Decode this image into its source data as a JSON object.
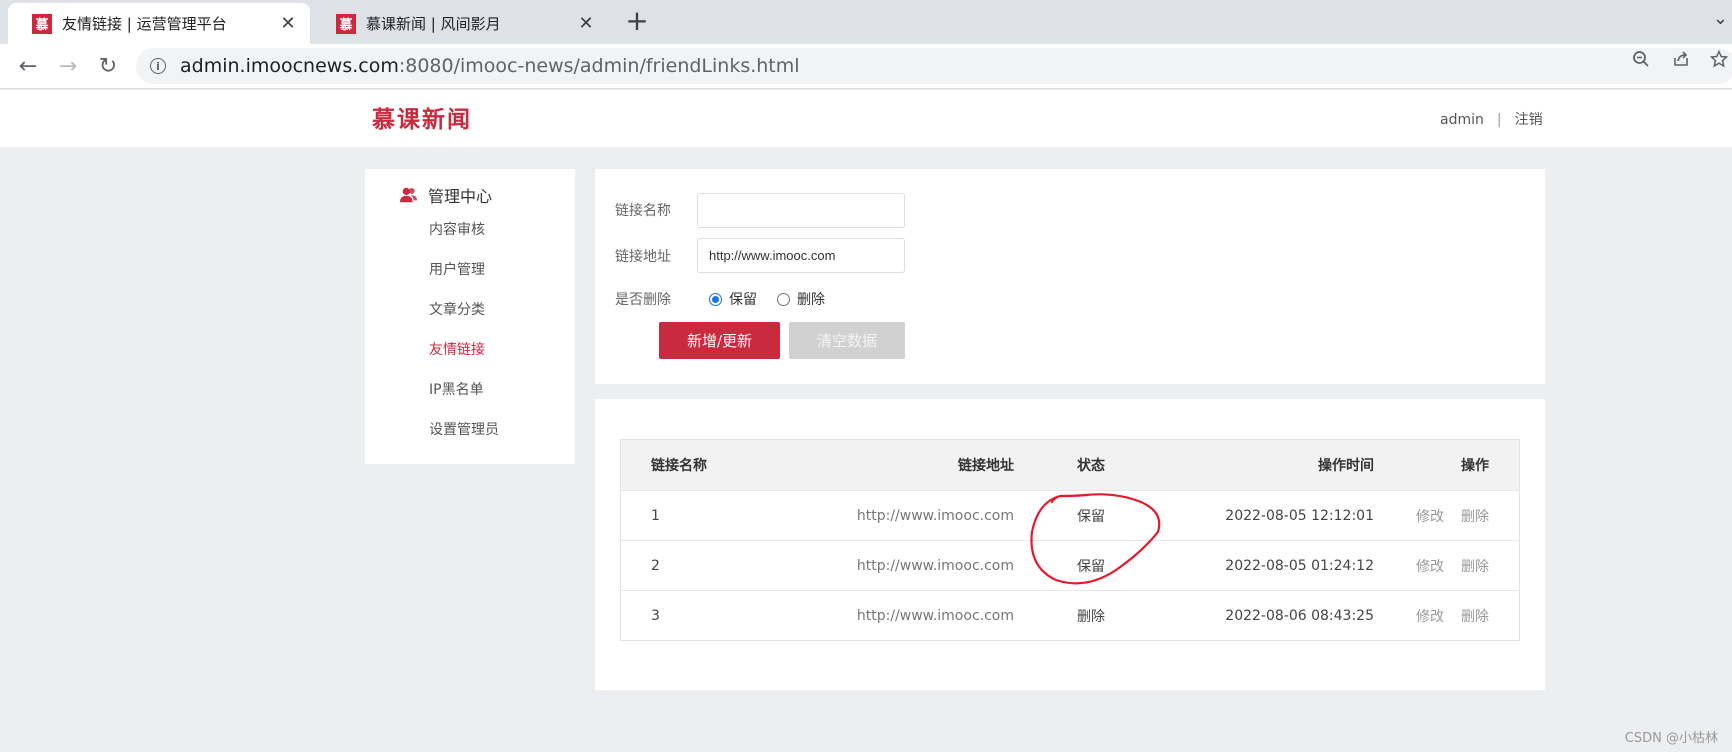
{
  "browser": {
    "tabs": [
      {
        "favicon": "慕",
        "title": "友情链接 | 运营管理平台",
        "active": true
      },
      {
        "favicon": "慕",
        "title": "慕课新闻 | 风间影月",
        "active": false
      }
    ],
    "url_host": "admin.imoocnews.com",
    "url_rest": ":8080/imooc-news/admin/friendLinks.html"
  },
  "header": {
    "logo": "慕课新闻",
    "username": "admin",
    "separator": "|",
    "logout": "注销"
  },
  "sidebar": {
    "title": "管理中心",
    "items": [
      {
        "label": "内容审核",
        "active": false
      },
      {
        "label": "用户管理",
        "active": false
      },
      {
        "label": "文章分类",
        "active": false
      },
      {
        "label": "友情链接",
        "active": true
      },
      {
        "label": "IP黑名单",
        "active": false
      },
      {
        "label": "设置管理员",
        "active": false
      }
    ]
  },
  "form": {
    "name_label": "链接名称",
    "name_value": "",
    "url_label": "链接地址",
    "url_value": "http://www.imooc.com",
    "delete_label": "是否删除",
    "option_keep": "保留",
    "option_delete": "删除",
    "selected": "保留",
    "submit_label": "新增/更新",
    "clear_label": "清空数据"
  },
  "table": {
    "headers": [
      "链接名称",
      "链接地址",
      "状态",
      "操作时间",
      "操作"
    ],
    "rows": [
      {
        "name": "1",
        "url": "http://www.imooc.com",
        "status": "保留",
        "time": "2022-08-05 12:12:01",
        "edit": "修改",
        "delete": "删除"
      },
      {
        "name": "2",
        "url": "http://www.imooc.com",
        "status": "保留",
        "time": "2022-08-05 01:24:12",
        "edit": "修改",
        "delete": "删除"
      },
      {
        "name": "3",
        "url": "http://www.imooc.com",
        "status": "删除",
        "time": "2022-08-06 08:43:25",
        "edit": "修改",
        "delete": "删除"
      }
    ]
  },
  "annotation_color": "#e8192c",
  "accent_color": "#c92a3e",
  "watermark": "CSDN @小枯林"
}
